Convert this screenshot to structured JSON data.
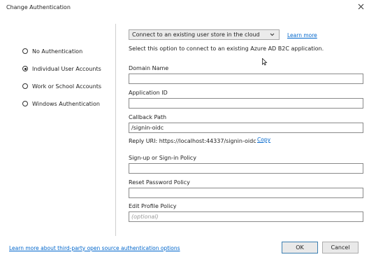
{
  "window": {
    "title": "Change Authentication",
    "close_glyph": "close-icon"
  },
  "auth_options": [
    {
      "label": "No Authentication",
      "selected": false
    },
    {
      "label": "Individual User Accounts",
      "selected": true
    },
    {
      "label": "Work or School Accounts",
      "selected": false
    },
    {
      "label": "Windows Authentication",
      "selected": false
    }
  ],
  "store": {
    "selected": "Connect to an existing user store in the cloud",
    "learn_more": "Learn more",
    "description": "Select this option to connect to an existing Azure AD B2C application."
  },
  "fields": {
    "domain_name": {
      "label": "Domain Name",
      "value": ""
    },
    "application_id": {
      "label": "Application ID",
      "value": ""
    },
    "callback_path": {
      "label": "Callback Path",
      "value": "/signin-oidc"
    },
    "reply_uri": {
      "text": "Reply URI: https://localhost:44337/signin-oidc",
      "copy": "Copy"
    },
    "signup_policy": {
      "label": "Sign-up or Sign-in Policy",
      "value": ""
    },
    "reset_password_policy": {
      "label": "Reset Password Policy",
      "value": ""
    },
    "edit_profile_policy": {
      "label": "Edit Profile Policy",
      "value": "",
      "placeholder": "(optional)"
    }
  },
  "footer": {
    "link": "Learn more about third-party open source authentication options",
    "ok": "OK",
    "cancel": "Cancel"
  },
  "colors": {
    "link": "#0066cc",
    "ok_border": "#3c7fb1"
  }
}
